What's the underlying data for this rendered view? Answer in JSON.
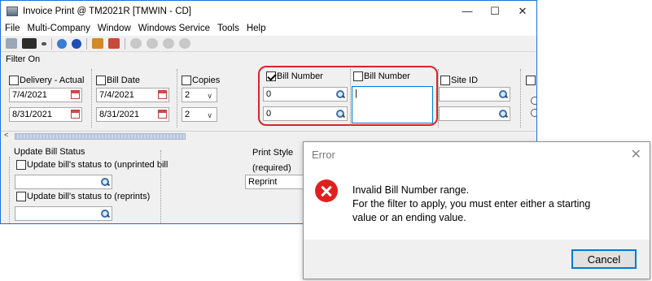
{
  "window": {
    "title": "Invoice Print @ TM2021R [TMWIN - CD]",
    "controls": {
      "minimize": "—",
      "maximize": "☐",
      "close": "✕"
    }
  },
  "menu": [
    "File",
    "Multi-Company",
    "Window",
    "Windows Service",
    "Tools",
    "Help"
  ],
  "filter": {
    "section_label": "Filter On",
    "delivery": {
      "label": "Delivery - Actual",
      "checked": false,
      "from": "7/4/2021",
      "to": "8/31/2021"
    },
    "bill_date": {
      "label": "Bill Date",
      "checked": false,
      "from": "7/4/2021",
      "to": "8/31/2021"
    },
    "copies": {
      "label": "Copies",
      "checked": false,
      "value1": "2",
      "value2": "2"
    },
    "bill_number_from": {
      "label": "Bill Number",
      "checked": true,
      "value1": "0",
      "value2": "0"
    },
    "bill_number_to": {
      "label": "Bill Number",
      "checked": false,
      "value": "|"
    },
    "site_id": {
      "label": "Site ID",
      "checked": false
    }
  },
  "scrollbar": {
    "left_arrow": "<"
  },
  "bill_status": {
    "group_label": "Update Bill Status",
    "unprinted_label": "Update bill's status to (unprinted bill",
    "reprints_label": "Update bill's status to (reprints)"
  },
  "print_style": {
    "label": "Print Style",
    "required": "(required)",
    "value": "Reprint"
  },
  "dialog": {
    "title": "Error",
    "close": "✕",
    "line1": "Invalid Bill Number range.",
    "line2": "For the filter to apply, you must enter either a starting",
    "line3": "value or an ending value.",
    "cancel_label": "Cancel"
  },
  "colors": {
    "highlight": "#d9242a",
    "error_icon": "#e0201f",
    "focus": "#0078d7"
  }
}
